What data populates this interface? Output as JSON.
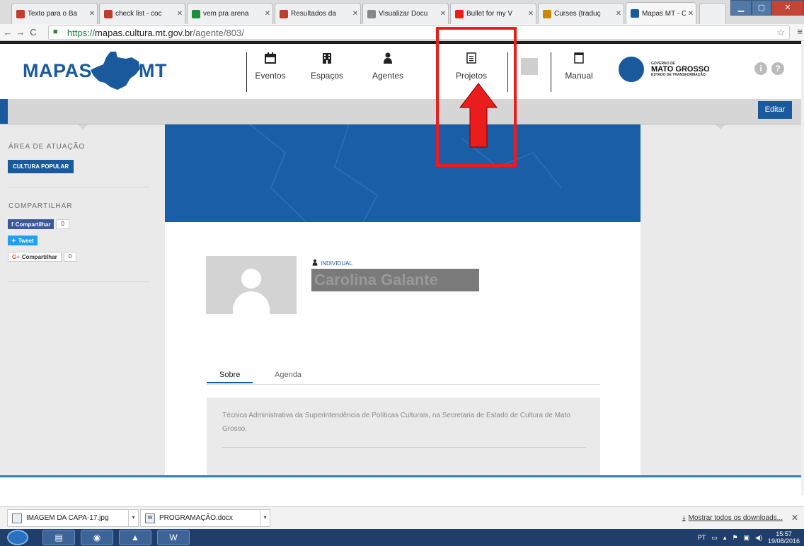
{
  "browser": {
    "tabs": [
      {
        "title": "Texto para o Ba",
        "icon": "gmail-icon",
        "color": "#c33b2e"
      },
      {
        "title": "check list - coc",
        "icon": "gmail-icon",
        "color": "#c33b2e"
      },
      {
        "title": "vem pra arena",
        "icon": "sheets-icon",
        "color": "#1e8e3e"
      },
      {
        "title": "Resultados da",
        "icon": "gmail-icon",
        "color": "#c33b2e"
      },
      {
        "title": "Visualizar Docu",
        "icon": "drive-icon",
        "color": "#888888"
      },
      {
        "title": "Bullet for my V",
        "icon": "youtube-icon",
        "color": "#e62117"
      },
      {
        "title": "Curses (traduç",
        "icon": "music-icon",
        "color": "#c98a00"
      },
      {
        "title": "Mapas MT - Ca",
        "icon": "mapas-icon",
        "color": "#1a5a9c"
      }
    ],
    "active_tab": 7,
    "url": {
      "scheme": "https://",
      "host": "mapas.cultura.mt.gov.br",
      "path": "/agente/803/"
    }
  },
  "site": {
    "logo": {
      "left": "MAPAS",
      "right": "MT"
    },
    "nav": [
      {
        "label": "Eventos",
        "icon": "calendar-icon"
      },
      {
        "label": "Espaços",
        "icon": "building-icon"
      },
      {
        "label": "Agentes",
        "icon": "person-icon"
      },
      {
        "label": "Projetos",
        "icon": "document-icon"
      },
      {
        "label": "Manual",
        "icon": "square-icon"
      }
    ],
    "gov": {
      "line1": "GOVERNO DE",
      "line2": "MATO GROSSO",
      "line3": "ESTADO DE TRANSFORMAÇÃO"
    },
    "info_icon": "i",
    "help_icon": "?",
    "edit_label": "Editar"
  },
  "sidebar": {
    "area_title": "ÁREA DE ATUAÇÃO",
    "area_tag": "CULTURA POPULAR",
    "share_title": "COMPARTILHAR",
    "facebook": {
      "label": "Compartilhar",
      "count": "0"
    },
    "twitter": {
      "label": "Tweet"
    },
    "google": {
      "label": "Compartilhar",
      "count": "0"
    }
  },
  "profile": {
    "type": "INDIVIDUAL",
    "name": "Carolina Galante",
    "tabs": [
      "Sobre",
      "Agenda"
    ],
    "about": "Técnica Administrativa da Superintendência de Políticas Culturais, na Secretaria de Estado de Cultura de Mato Grosso."
  },
  "downloads": {
    "items": [
      "IMAGEM DA CAPA-17.jpg",
      "PROGRAMAÇÃO.docx"
    ],
    "show_all": "Mostrar todos os downloads..."
  },
  "taskbar": {
    "lang": "PT",
    "time": "15:57",
    "date": "19/08/2016"
  },
  "colors": {
    "brand_blue": "#1a5a9c",
    "cover_blue": "#1b5ea8",
    "annotation_red": "#ea1c1c"
  }
}
